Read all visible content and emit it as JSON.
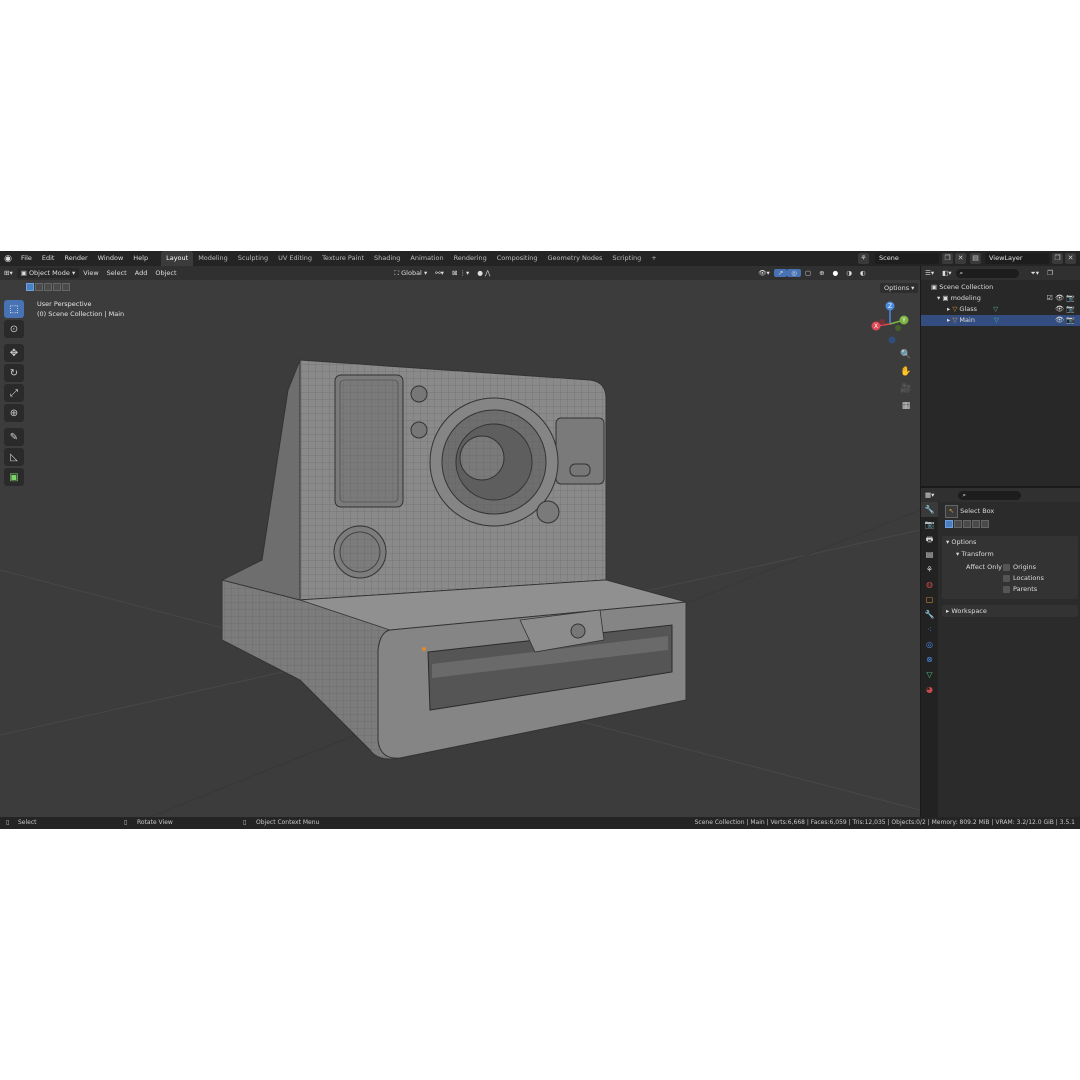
{
  "topbar": {
    "menus": [
      "File",
      "Edit",
      "Render",
      "Window",
      "Help"
    ],
    "workspaces": [
      "Layout",
      "Modeling",
      "Sculpting",
      "UV Editing",
      "Texture Paint",
      "Shading",
      "Animation",
      "Rendering",
      "Compositing",
      "Geometry Nodes",
      "Scripting"
    ],
    "active_workspace": "Layout",
    "add_tab": "+",
    "scene": "Scene",
    "view_layer": "ViewLayer"
  },
  "viewport_header": {
    "mode": "Object Mode",
    "menus": [
      "View",
      "Select",
      "Add",
      "Object"
    ],
    "orientation": "Global"
  },
  "viewport": {
    "perspective": "User Perspective",
    "collection_info": "(0) Scene Collection | Main",
    "options": "Options"
  },
  "gizmo": {
    "z": "Z",
    "y": "Y",
    "x": "X"
  },
  "outliner": {
    "root": "Scene Collection",
    "collection": "modeling",
    "objects": [
      {
        "name": "Glass",
        "selected": false
      },
      {
        "name": "Main",
        "selected": true
      }
    ]
  },
  "properties": {
    "tool_name": "Select Box",
    "options_label": "Options",
    "transform_label": "Transform",
    "affect_only_label": "Affect Only",
    "checks": [
      "Origins",
      "Locations",
      "Parents"
    ],
    "workspace_label": "Workspace"
  },
  "statusbar": {
    "left_select": "Select",
    "rotate": "Rotate View",
    "context": "Object Context Menu",
    "stats": "Scene Collection | Main | Verts:6,668 | Faces:6,059 | Tris:12,035 | Objects:0/2 | Memory: 809.2 MiB | VRAM: 3.2/12.0 GiB | 3.5.1"
  },
  "colors": {
    "accent": "#4772b3",
    "selected_row": "#334d80",
    "x_axis": "#e04a55",
    "y_axis": "#7cb342",
    "z_axis": "#4a8ae0"
  }
}
